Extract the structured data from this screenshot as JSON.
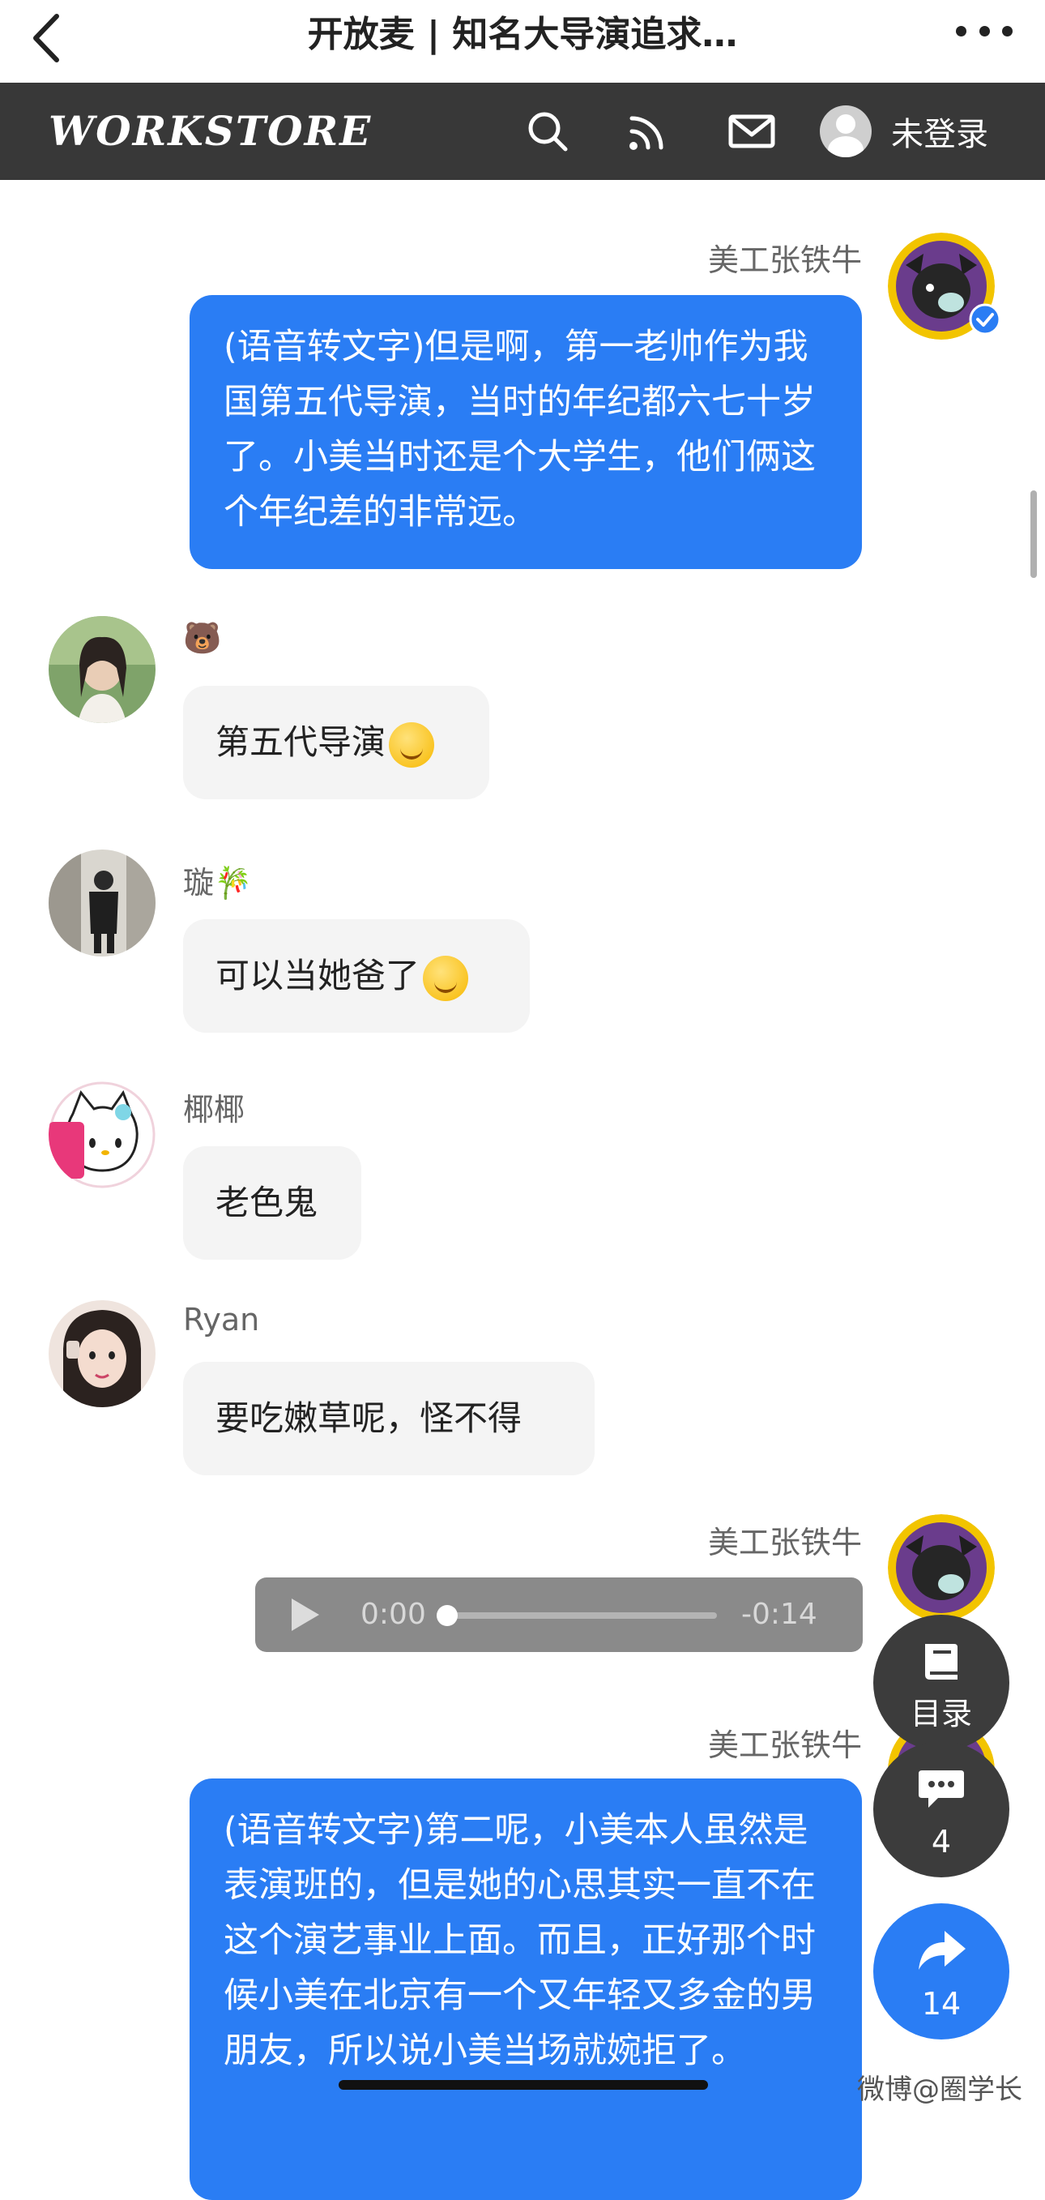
{
  "titlebar": {
    "title": "开放麦 | 知名大导演追求…"
  },
  "header": {
    "logo": "WORKSTORE",
    "login_label": "未登录"
  },
  "messages": [
    {
      "name": "美工张铁牛",
      "text": "(语音转文字)但是啊，第一老帅作为我国第五代导演，当时的年纪都六七十岁了。小美当时还是个大学生，他们俩这个年纪差的非常远。"
    },
    {
      "name": "🐻",
      "text": "第五代导演"
    },
    {
      "name": "璇🎋",
      "text": "可以当她爸了"
    },
    {
      "name": "椰椰",
      "text": "老色鬼"
    },
    {
      "name": "Ryan",
      "text": "要吃嫩草呢，怪不得"
    },
    {
      "name": "美工张铁牛",
      "audio": {
        "current": "0:00",
        "remaining": "-0:14"
      }
    },
    {
      "name": "美工张铁牛",
      "text": "(语音转文字)第二呢，小美本人虽然是表演班的，但是她的心思其实一直不在这个演艺事业上面。而且，正好那个时候小美在北京有一个又年轻又多金的男朋友，所以说小美当场就婉拒了。"
    }
  ],
  "fabs": {
    "toc_label": "目录",
    "comments_count": "4",
    "share_count": "14"
  },
  "watermark": "微博@圈学长",
  "colors": {
    "bubble_blue": "#2a7df4",
    "header_bg": "#383838",
    "bubble_grey": "#f4f4f4"
  }
}
